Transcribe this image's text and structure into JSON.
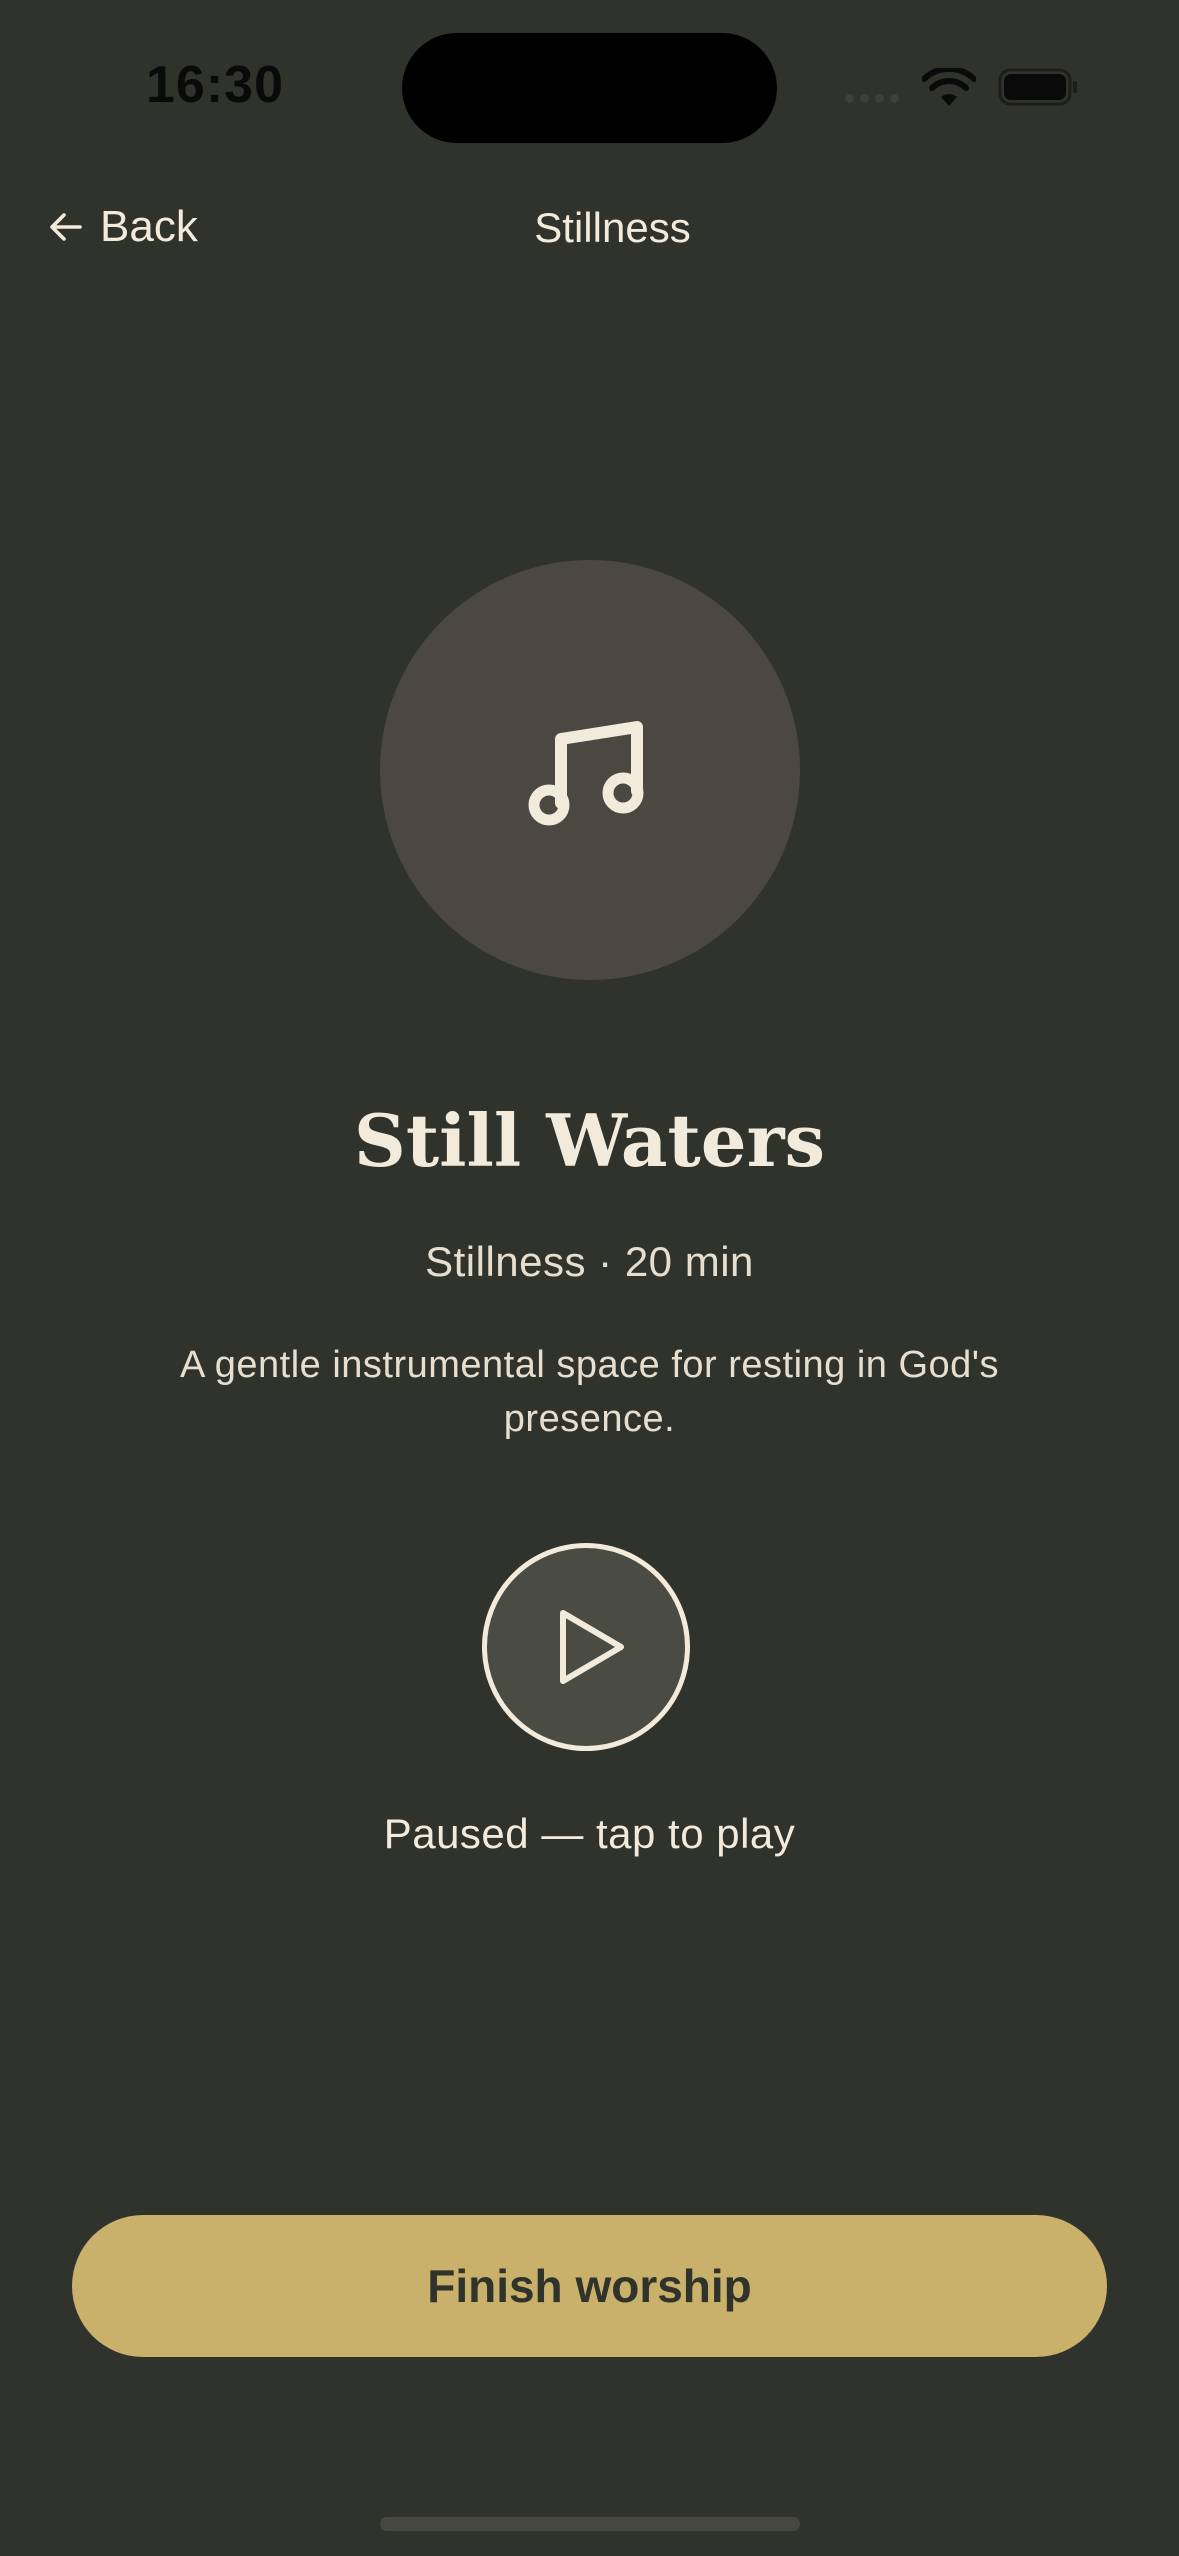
{
  "status_bar": {
    "time": "16:30"
  },
  "nav": {
    "back_label": "Back",
    "title": "Stillness"
  },
  "track": {
    "artwork_icon": "music-note-icon",
    "title": "Still Waters",
    "meta": "Stillness · 20 min",
    "description": "A gentle instrumental space for resting in God's presence."
  },
  "player": {
    "play_icon": "play-icon",
    "status": "Paused — tap to play"
  },
  "actions": {
    "finish_label": "Finish worship"
  },
  "colors": {
    "background": "#30322c",
    "artwork_bg": "#4a4841",
    "text": "#f2ebdc",
    "accent": "#c9b06b"
  }
}
